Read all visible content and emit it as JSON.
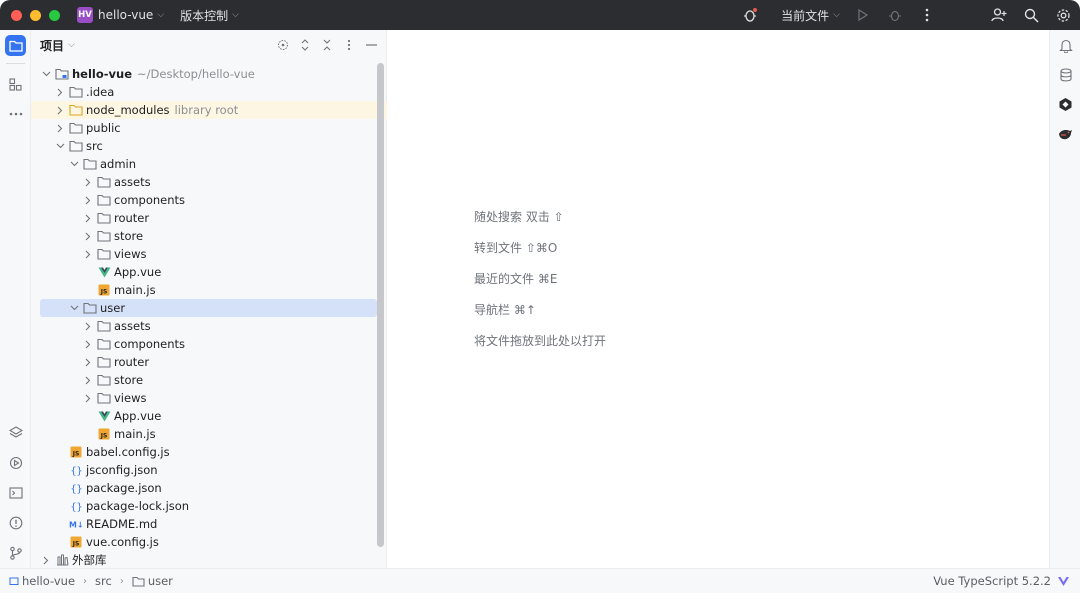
{
  "titlebar": {
    "project_badge": "HV",
    "project_name": "hello-vue",
    "vcs_label": "版本控制",
    "run_config": "当前文件"
  },
  "project_panel": {
    "title": "项目"
  },
  "tree": [
    {
      "label": "hello-vue",
      "hint": "~/Desktop/hello-vue",
      "depth": 0,
      "chev": "down",
      "icon": "module-folder-icon",
      "bold": true
    },
    {
      "label": ".idea",
      "hint": "",
      "depth": 1,
      "chev": "right",
      "icon": "folder-icon"
    },
    {
      "label": "node_modules",
      "hint": "library root",
      "depth": 1,
      "chev": "right",
      "icon": "folder-yellow-icon",
      "highlight": true
    },
    {
      "label": "public",
      "hint": "",
      "depth": 1,
      "chev": "right",
      "icon": "folder-icon"
    },
    {
      "label": "src",
      "hint": "",
      "depth": 1,
      "chev": "down",
      "icon": "folder-icon"
    },
    {
      "label": "admin",
      "hint": "",
      "depth": 2,
      "chev": "down",
      "icon": "folder-icon"
    },
    {
      "label": "assets",
      "hint": "",
      "depth": 3,
      "chev": "right",
      "icon": "folder-icon"
    },
    {
      "label": "components",
      "hint": "",
      "depth": 3,
      "chev": "right",
      "icon": "folder-icon"
    },
    {
      "label": "router",
      "hint": "",
      "depth": 3,
      "chev": "right",
      "icon": "folder-icon"
    },
    {
      "label": "store",
      "hint": "",
      "depth": 3,
      "chev": "right",
      "icon": "folder-icon"
    },
    {
      "label": "views",
      "hint": "",
      "depth": 3,
      "chev": "right",
      "icon": "folder-icon"
    },
    {
      "label": "App.vue",
      "hint": "",
      "depth": 3,
      "chev": "",
      "icon": "vue-file-icon"
    },
    {
      "label": "main.js",
      "hint": "",
      "depth": 3,
      "chev": "",
      "icon": "js-file-icon"
    },
    {
      "label": "user",
      "hint": "",
      "depth": 2,
      "chev": "down",
      "icon": "folder-icon",
      "selected": true
    },
    {
      "label": "assets",
      "hint": "",
      "depth": 3,
      "chev": "right",
      "icon": "folder-icon"
    },
    {
      "label": "components",
      "hint": "",
      "depth": 3,
      "chev": "right",
      "icon": "folder-icon"
    },
    {
      "label": "router",
      "hint": "",
      "depth": 3,
      "chev": "right",
      "icon": "folder-icon"
    },
    {
      "label": "store",
      "hint": "",
      "depth": 3,
      "chev": "right",
      "icon": "folder-icon"
    },
    {
      "label": "views",
      "hint": "",
      "depth": 3,
      "chev": "right",
      "icon": "folder-icon"
    },
    {
      "label": "App.vue",
      "hint": "",
      "depth": 3,
      "chev": "",
      "icon": "vue-file-icon"
    },
    {
      "label": "main.js",
      "hint": "",
      "depth": 3,
      "chev": "",
      "icon": "js-file-icon"
    },
    {
      "label": "babel.config.js",
      "hint": "",
      "depth": 1,
      "chev": "",
      "icon": "js-file-icon"
    },
    {
      "label": "jsconfig.json",
      "hint": "",
      "depth": 1,
      "chev": "",
      "icon": "json-file-icon"
    },
    {
      "label": "package.json",
      "hint": "",
      "depth": 1,
      "chev": "",
      "icon": "json-file-icon"
    },
    {
      "label": "package-lock.json",
      "hint": "",
      "depth": 1,
      "chev": "",
      "icon": "json-file-icon"
    },
    {
      "label": "README.md",
      "hint": "",
      "depth": 1,
      "chev": "",
      "icon": "markdown-file-icon"
    },
    {
      "label": "vue.config.js",
      "hint": "",
      "depth": 1,
      "chev": "",
      "icon": "js-file-icon"
    },
    {
      "label": "外部库",
      "hint": "",
      "depth": 0,
      "chev": "right",
      "icon": "library-icon"
    }
  ],
  "editor_hints": [
    "随处搜索 双击 ⇧",
    "转到文件 ⇧⌘O",
    "最近的文件 ⌘E",
    "导航栏 ⌘↑",
    "将文件拖放到此处以打开"
  ],
  "statusbar": {
    "crumbs": [
      "hello-vue",
      "src",
      "user"
    ],
    "language": "Vue TypeScript 5.2.2"
  },
  "colors": {
    "accent": "#3574f0",
    "titlebar": "#2b2d30",
    "panel": "#f7f8fa",
    "selection": "#d5e1f9",
    "library_highlight": "#fdf6e3",
    "vue_green": "#42b883",
    "js_yellow": "#f0a732"
  }
}
